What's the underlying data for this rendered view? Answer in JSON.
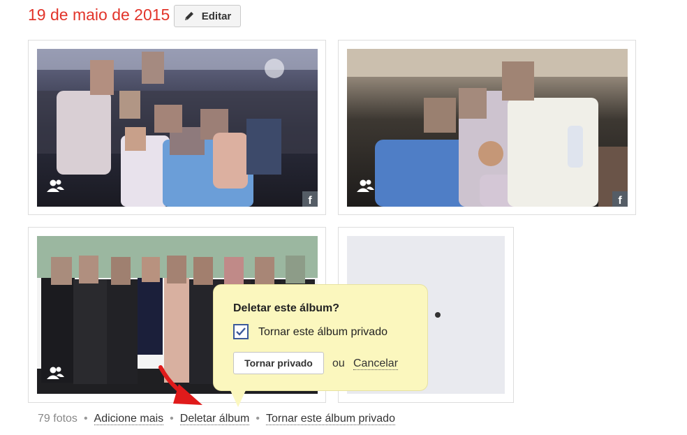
{
  "album": {
    "date": "19 de maio de 2015",
    "edit_label": "Editar"
  },
  "photos": [
    {
      "shared_icon": "people-icon",
      "source_icon": "facebook-icon",
      "source_glyph": "f"
    },
    {
      "shared_icon": "people-icon",
      "source_icon": "facebook-icon",
      "source_glyph": "f"
    },
    {
      "shared_icon": "people-icon"
    }
  ],
  "popover": {
    "title": "Deletar este álbum?",
    "checkbox_label": "Tornar este álbum privado",
    "checkbox_checked": true,
    "private_button": "Tornar privado",
    "or_text": "ou",
    "cancel_link": "Cancelar"
  },
  "footer": {
    "count": "79 fotos",
    "add_more": "Adicione mais",
    "delete_album": "Deletar álbum",
    "make_private": "Tornar este álbum privado"
  },
  "colors": {
    "date": "#e2342a",
    "popover_bg": "#fbf7be",
    "checkbox_border": "#3c5a9a",
    "arrow": "#e01b1b"
  }
}
